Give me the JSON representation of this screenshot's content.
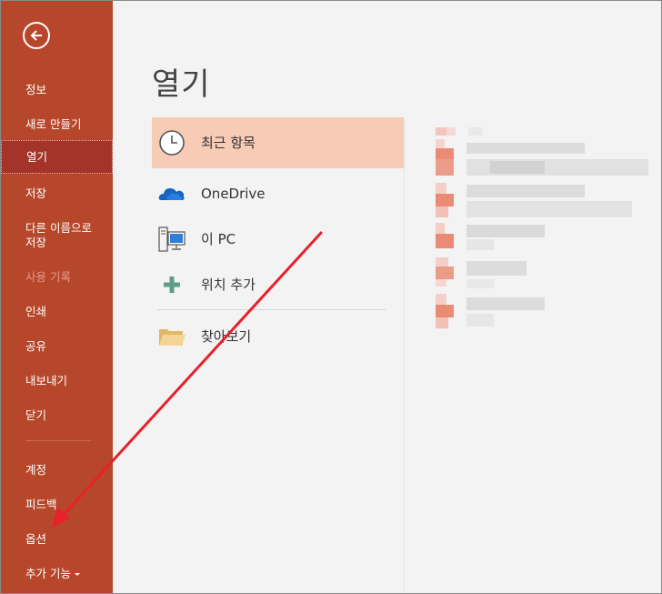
{
  "title": "열기",
  "sidebar": {
    "items": [
      {
        "label": "정보"
      },
      {
        "label": "새로 만들기"
      },
      {
        "label": "열기"
      },
      {
        "label": "저장"
      },
      {
        "label": "다른 이름으로"
      },
      {
        "label": "저장"
      },
      {
        "label": "사용 기록"
      },
      {
        "label": "인쇄"
      },
      {
        "label": "공유"
      },
      {
        "label": "내보내기"
      },
      {
        "label": "닫기"
      },
      {
        "label": "계정"
      },
      {
        "label": "피드백"
      },
      {
        "label": "옵션"
      },
      {
        "label": "추가 기능"
      }
    ]
  },
  "places": {
    "items": [
      {
        "label": "최근 항목",
        "icon": "clock-icon"
      },
      {
        "label": "OneDrive",
        "icon": "cloud-icon"
      },
      {
        "label": "이 PC",
        "icon": "computer-icon"
      },
      {
        "label": "위치 추가",
        "icon": "plus-icon"
      },
      {
        "label": "찾아보기",
        "icon": "folder-icon"
      }
    ]
  },
  "colors": {
    "sidebar": "#b7472a",
    "sidebar_active": "#a4332a",
    "selected_place": "#f8cbb6",
    "arrow": "#e8202a"
  }
}
